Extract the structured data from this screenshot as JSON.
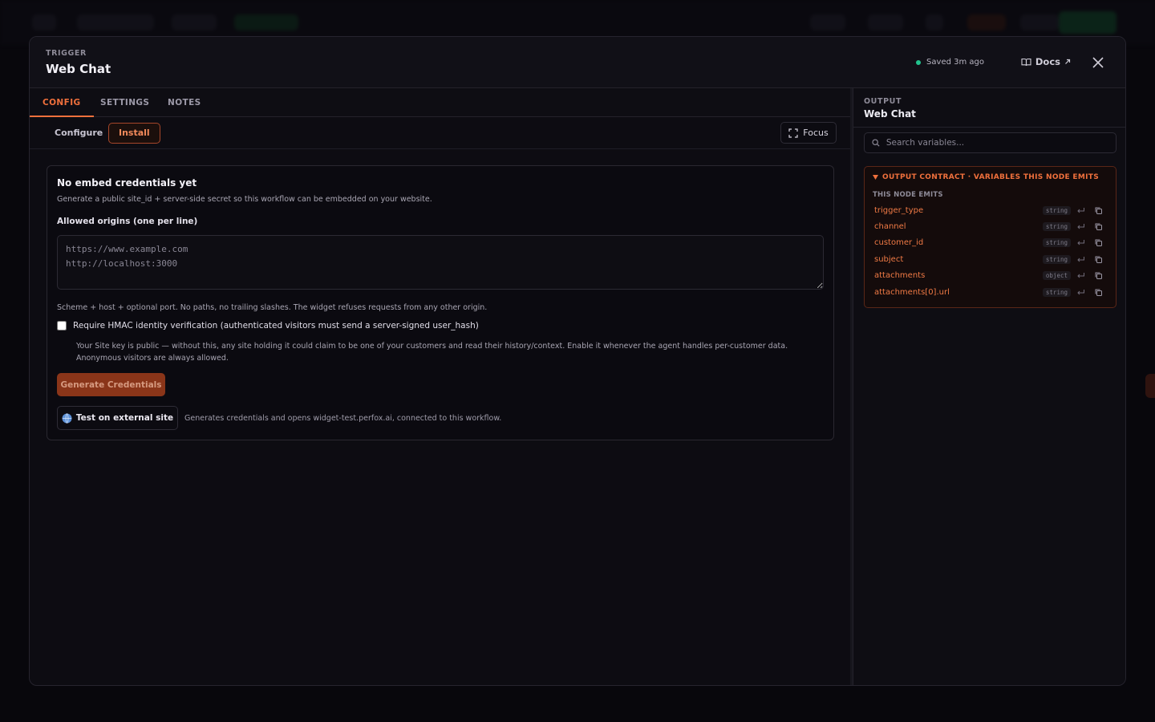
{
  "header": {
    "kicker": "TRIGGER",
    "title": "Web Chat",
    "saved_status": "Saved 3m ago",
    "docs_label": "Docs"
  },
  "tabs": [
    {
      "label": "CONFIG",
      "active": true
    },
    {
      "label": "SETTINGS",
      "active": false
    },
    {
      "label": "NOTES",
      "active": false
    }
  ],
  "subtabs": [
    {
      "label": "Configure",
      "active": false
    },
    {
      "label": "Install",
      "active": true
    }
  ],
  "focus_label": "Focus",
  "install": {
    "title": "No embed credentials yet",
    "description": "Generate a public site_id + server-side secret so this workflow can be embedded on your website.",
    "origins_label": "Allowed origins (one per line)",
    "origins_placeholder": "https://www.example.com\nhttp://localhost:3000",
    "origins_hint": "Scheme + host + optional port. No paths, no trailing slashes. The widget refuses requests from any other origin.",
    "hmac_label": "Require HMAC identity verification (authenticated visitors must send a server-signed user_hash)",
    "hmac_checked": false,
    "hmac_note": "Your Site key is public — without this, any site holding it could claim to be one of your customers and read their history/context. Enable it whenever the agent handles per-customer data. Anonymous visitors are always allowed.",
    "generate_label": "Generate Credentials",
    "external_label": "Test on external site",
    "external_note": "Generates credentials and opens widget-test.perfox.ai, connected to this workflow."
  },
  "output": {
    "kicker": "OUTPUT",
    "title": "Web Chat",
    "search_placeholder": "Search variables...",
    "contract_title": "OUTPUT CONTRACT · VARIABLES THIS NODE EMITS",
    "contract_subtitle": "THIS NODE EMITS",
    "variables": [
      {
        "name": "trigger_type",
        "type": "string"
      },
      {
        "name": "channel",
        "type": "string"
      },
      {
        "name": "customer_id",
        "type": "string"
      },
      {
        "name": "subject",
        "type": "string"
      },
      {
        "name": "attachments",
        "type": "object"
      },
      {
        "name": "attachments[0].url",
        "type": "string"
      }
    ]
  },
  "colors": {
    "accent": "#f0703c",
    "saved_dot": "#22c38e",
    "generate_bg": "#8a3519"
  }
}
